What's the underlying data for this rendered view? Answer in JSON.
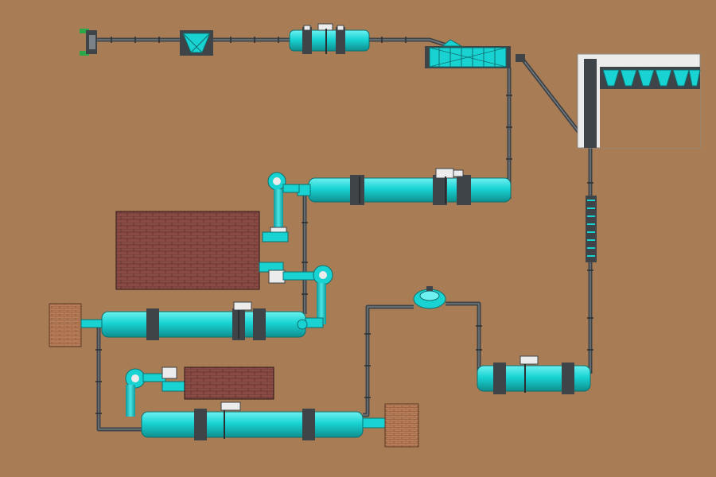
{
  "colors": {
    "background": "#a87d55",
    "equipment": "#19d3d3",
    "equipment_dark": "#0f9a9a",
    "conveyor": "#3f4448",
    "conveyor_light": "#7c8388",
    "brick": "#8a4a44",
    "brick_mortar": "#5e3330",
    "light_brick": "#b87d58",
    "feeder_green": "#2aa84a",
    "white_bay": "#ececec"
  },
  "diagram": {
    "components": [
      {
        "id": "feed-inlet",
        "kind": "feeder-inlet"
      },
      {
        "id": "feed-hopper",
        "kind": "hopper"
      },
      {
        "id": "rotary-drum-1",
        "kind": "rotary-drum"
      },
      {
        "id": "screen-1",
        "kind": "drum-screen"
      },
      {
        "id": "storage-bins",
        "kind": "bin-row"
      },
      {
        "id": "rotary-dryer-upper",
        "kind": "rotary-drum"
      },
      {
        "id": "rotary-dryer-middle",
        "kind": "rotary-drum"
      },
      {
        "id": "rotary-dryer-lower",
        "kind": "rotary-drum"
      },
      {
        "id": "rotary-cooler-right",
        "kind": "rotary-drum"
      },
      {
        "id": "cyclone-fan-upper",
        "kind": "fan"
      },
      {
        "id": "cyclone-fan-middle",
        "kind": "fan"
      },
      {
        "id": "cyclone-fan-lower",
        "kind": "fan"
      },
      {
        "id": "furnace-large",
        "kind": "brick-furnace"
      },
      {
        "id": "furnace-lower",
        "kind": "brick-furnace"
      },
      {
        "id": "heat-source-left",
        "kind": "hot-air-stove"
      },
      {
        "id": "heat-source-right",
        "kind": "hot-air-stove"
      },
      {
        "id": "granulator-disc",
        "kind": "disc"
      },
      {
        "id": "bucket-elevator",
        "kind": "elevator"
      }
    ]
  }
}
